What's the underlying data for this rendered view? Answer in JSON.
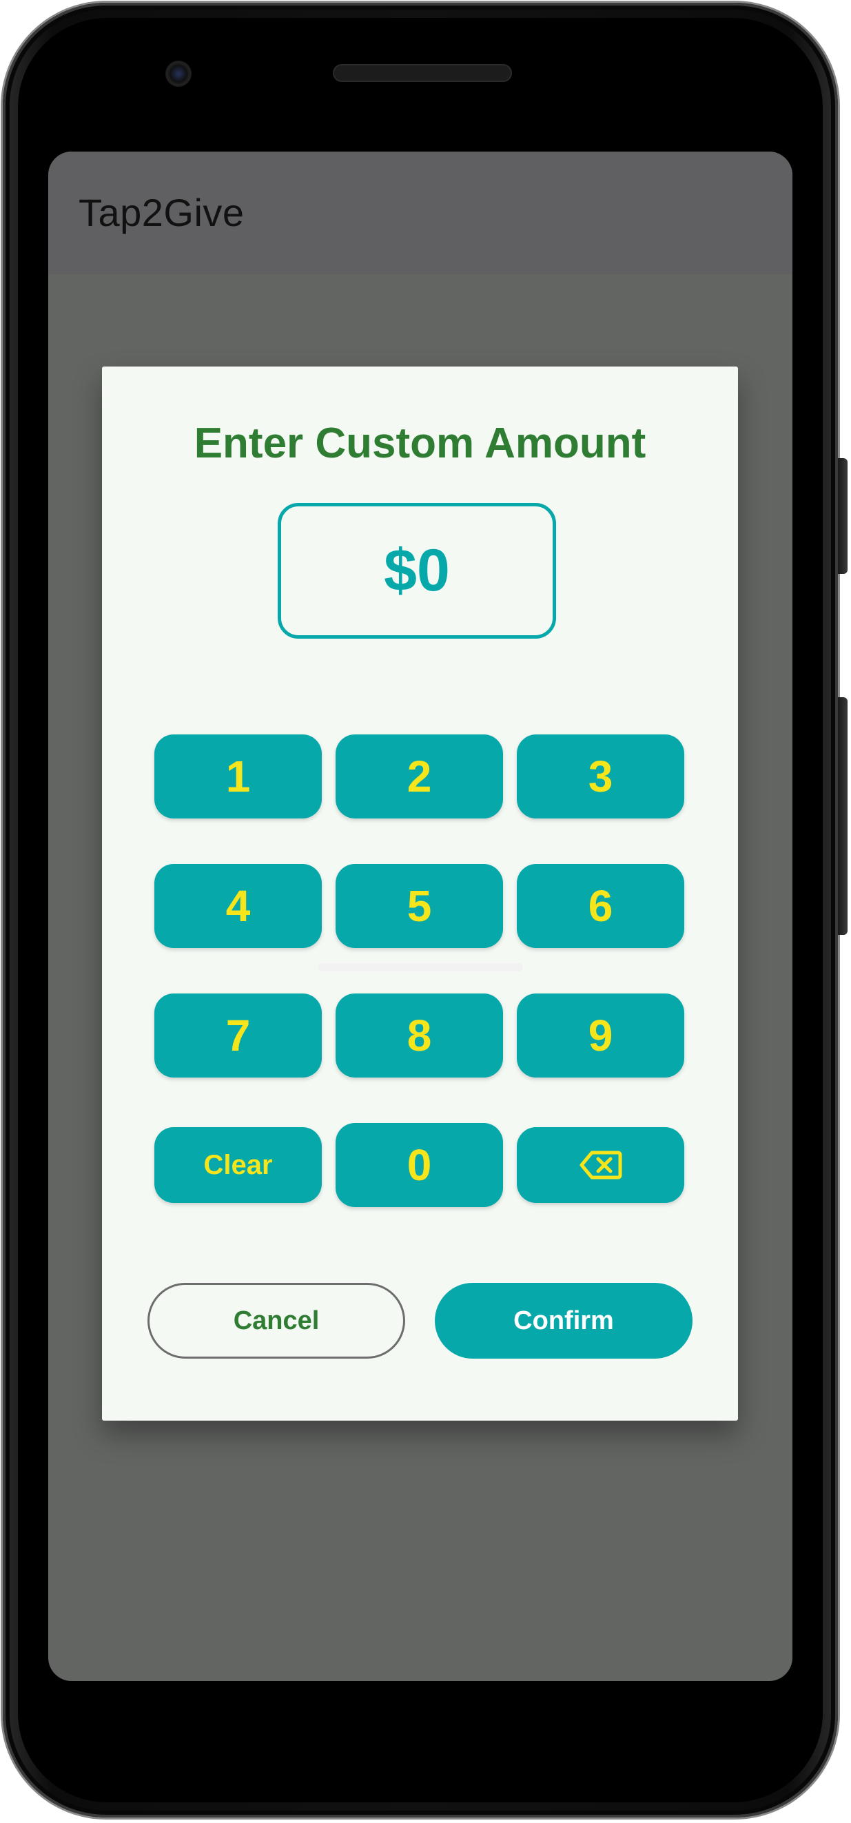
{
  "app": {
    "title": "Tap2Give"
  },
  "dialog": {
    "title": "Enter Custom Amount",
    "amount": "$0"
  },
  "keypad": {
    "keys": [
      "1",
      "2",
      "3",
      "4",
      "5",
      "6",
      "7",
      "8",
      "9"
    ],
    "clear_label": "Clear",
    "zero_label": "0",
    "backspace_icon": "backspace-icon"
  },
  "actions": {
    "cancel_label": "Cancel",
    "confirm_label": "Confirm"
  },
  "colors": {
    "primary": "#06a8aa",
    "key_text": "#f7e51b",
    "title_green": "#2e7d32",
    "dialog_bg": "#f4f9f4",
    "scrim": "#636563"
  }
}
